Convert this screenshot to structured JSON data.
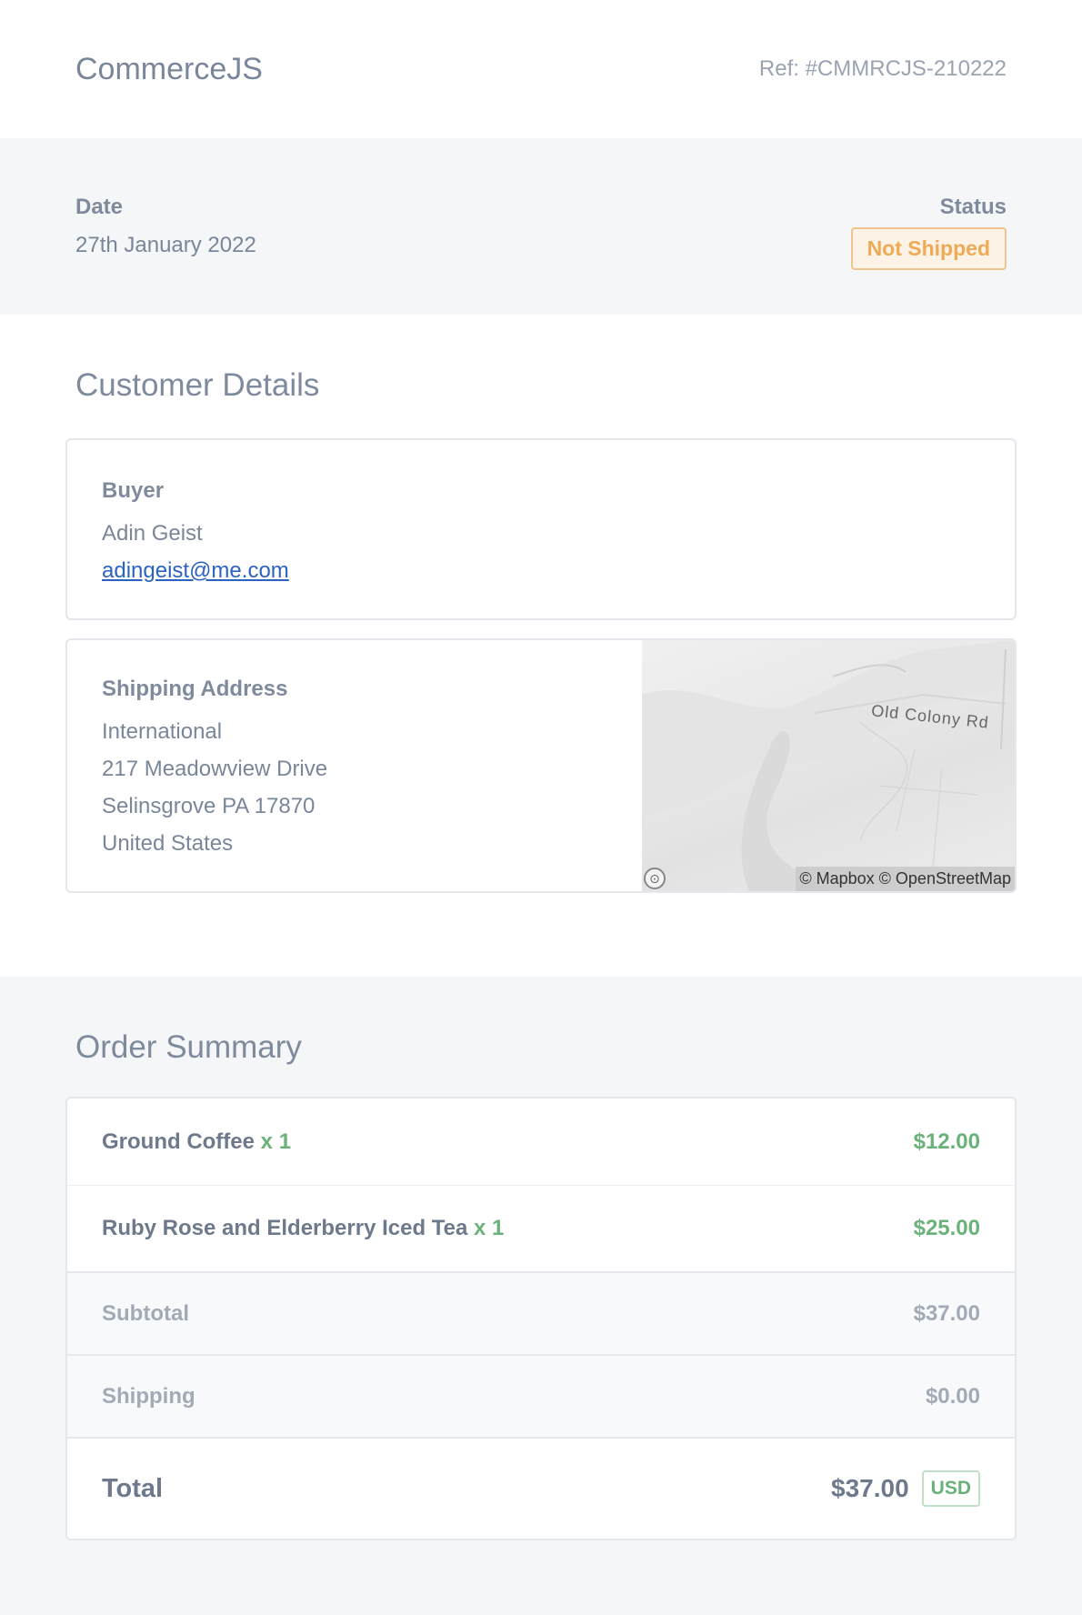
{
  "header": {
    "brand": "CommerceJS",
    "ref": "Ref: #CMMRCJS-210222"
  },
  "meta": {
    "date_label": "Date",
    "date_value": "27th January 2022",
    "status_label": "Status",
    "status_value": "Not Shipped"
  },
  "customer": {
    "title": "Customer Details",
    "buyer": {
      "label": "Buyer",
      "name": "Adin Geist",
      "email": "adingeist@me.com"
    },
    "shipping": {
      "label": "Shipping Address",
      "lines": [
        "International",
        "217 Meadowview Drive",
        "Selinsgrove PA 17870",
        "United States"
      ]
    },
    "map": {
      "road_label": "Old Colony Rd",
      "attribution": "© Mapbox © OpenStreetMap"
    }
  },
  "summary": {
    "title": "Order Summary",
    "items": [
      {
        "name": "Ground Coffee",
        "qty": "x 1",
        "price": "$12.00"
      },
      {
        "name": "Ruby Rose and Elderberry Iced Tea",
        "qty": "x 1",
        "price": "$25.00"
      }
    ],
    "subtotal_label": "Subtotal",
    "subtotal_value": "$37.00",
    "shipping_label": "Shipping",
    "shipping_value": "$0.00",
    "total_label": "Total",
    "total_value": "$37.00",
    "currency": "USD"
  },
  "colors": {
    "accent_green": "#6bb27a",
    "status_orange": "#eeaa55",
    "link_blue": "#2b63c0"
  }
}
